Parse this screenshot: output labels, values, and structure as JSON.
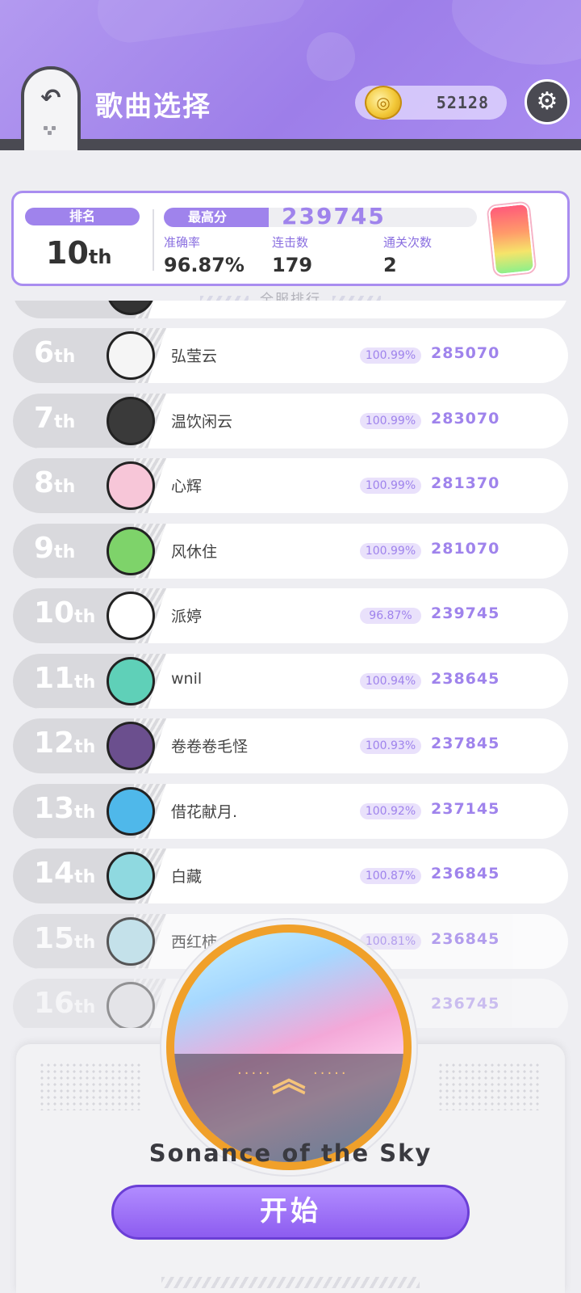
{
  "header": {
    "back_icon": "undo-arrow-icon",
    "title": "歌曲选择",
    "coins": "52128",
    "coin_icon": "coin-icon",
    "settings_icon": "gear-icon"
  },
  "stats": {
    "rank_label": "排名",
    "rank_value": "10",
    "rank_suffix": "th",
    "best_label": "最高分",
    "best_value": "239745",
    "accuracy_label": "准确率",
    "accuracy_value": "96.87%",
    "combo_label": "连击数",
    "combo_value": "179",
    "clears_label": "通关次数",
    "clears_value": "2"
  },
  "server_rank_label": "全服排行",
  "leaderboard": [
    {
      "rank": "6",
      "suffix": "th",
      "name": "弘莹云",
      "accuracy": "100.99%",
      "score": "285070",
      "avatar_color": "#f5f5f5"
    },
    {
      "rank": "7",
      "suffix": "th",
      "name": "温饮闲云",
      "accuracy": "100.99%",
      "score": "283070",
      "avatar_color": "#3a3a3a"
    },
    {
      "rank": "8",
      "suffix": "th",
      "name": "心辉",
      "accuracy": "100.99%",
      "score": "281370",
      "avatar_color": "#f7c6d8"
    },
    {
      "rank": "9",
      "suffix": "th",
      "name": "风休住",
      "accuracy": "100.99%",
      "score": "281070",
      "avatar_color": "#7ed36a"
    },
    {
      "rank": "10",
      "suffix": "th",
      "name": "派婷",
      "accuracy": "96.87%",
      "score": "239745",
      "avatar_color": "#ffffff"
    },
    {
      "rank": "11",
      "suffix": "th",
      "name": "wnil",
      "accuracy": "100.94%",
      "score": "238645",
      "avatar_color": "#5fd0b8"
    },
    {
      "rank": "12",
      "suffix": "th",
      "name": "卷卷卷毛怪",
      "accuracy": "100.93%",
      "score": "237845",
      "avatar_color": "#6b4f8e"
    },
    {
      "rank": "13",
      "suffix": "th",
      "name": "借花献月.",
      "accuracy": "100.92%",
      "score": "237145",
      "avatar_color": "#4fb8ea"
    },
    {
      "rank": "14",
      "suffix": "th",
      "name": "白藏",
      "accuracy": "100.87%",
      "score": "236845",
      "avatar_color": "#8fd9e0"
    },
    {
      "rank": "15",
      "suffix": "th",
      "name": "西红柿",
      "accuracy": "100.81%",
      "score": "236845",
      "avatar_color": "#b7dde8"
    },
    {
      "rank": "16",
      "suffix": "th",
      "name": "",
      "accuracy": "",
      "score": "236745",
      "avatar_color": "#d8d8dc"
    }
  ],
  "song": {
    "title": "Sonance of the Sky",
    "start_label": "开始",
    "expand_icon": "double-chevron-up-icon"
  }
}
